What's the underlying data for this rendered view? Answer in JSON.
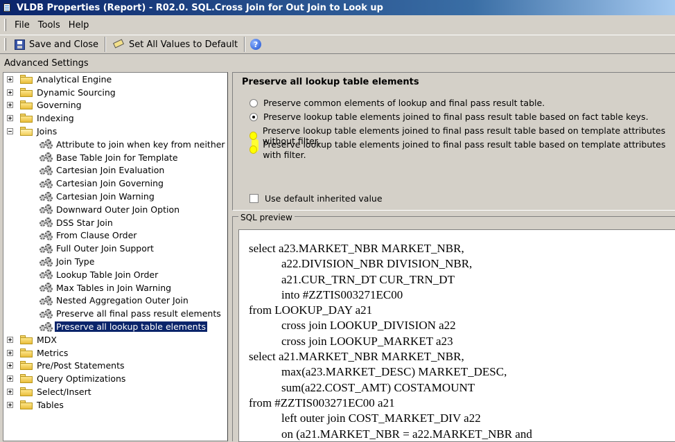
{
  "window": {
    "title": "VLDB Properties (Report) - R02.0. SQL.Cross Join for Out Join to Look up"
  },
  "menu": {
    "file": "File",
    "tools": "Tools",
    "help": "Help"
  },
  "toolbar": {
    "save_close": "Save and Close",
    "set_defaults": "Set All Values to Default",
    "help_glyph": "?"
  },
  "advanced_settings_label": "Advanced Settings",
  "tree": {
    "top": [
      "Analytical Engine",
      "Dynamic Sourcing",
      "Governing",
      "Indexing"
    ],
    "joins": {
      "label": "Joins",
      "children": [
        "Attribute to join when key from neither side can be supported by the other side",
        "Base Table Join for Template",
        "Cartesian Join Evaluation",
        "Cartesian Join Governing",
        "Cartesian Join Warning",
        "Downward Outer Join Option",
        "DSS Star Join",
        "From Clause Order",
        "Full Outer Join Support",
        "Join Type",
        "Lookup Table Join Order",
        "Max Tables in Join Warning",
        "Nested Aggregation Outer Join",
        "Preserve all final pass result elements",
        "Preserve all lookup table elements"
      ]
    },
    "bottom": [
      "MDX",
      "Metrics",
      "Pre/Post Statements",
      "Query Optimizations",
      "Select/Insert",
      "Tables"
    ]
  },
  "setting": {
    "title": "Preserve all lookup table elements",
    "options": [
      "Preserve common elements of lookup and final pass result table.",
      "Preserve lookup table elements joined to final pass result table based on fact table keys.",
      "Preserve lookup table elements joined to final pass result table based on template attributes without filter.",
      "Preserve lookup table elements joined to final pass result table based on template attributes with filter."
    ],
    "selected_index": 1,
    "use_default": "Use default inherited value"
  },
  "sql_preview": {
    "label": "SQL preview",
    "lines": [
      "select a23.MARKET_NBR MARKET_NBR,",
      "a22.DIVISION_NBR DIVISION_NBR,",
      "a21.CUR_TRN_DT CUR_TRN_DT",
      "into #ZZTIS003271EC00",
      "from LOOKUP_DAY a21",
      "cross join LOOKUP_DIVISION a22",
      "cross join LOOKUP_MARKET a23",
      "select a21.MARKET_NBR MARKET_NBR,",
      "max(a23.MARKET_DESC) MARKET_DESC,",
      "sum(a22.COST_AMT) COSTAMOUNT",
      "from #ZZTIS003271EC00 a21",
      "left outer join COST_MARKET_DIV a22",
      "on (a21.MARKET_NBR = a22.MARKET_NBR and"
    ]
  },
  "colors": {
    "title_bar": "#0a246a",
    "selection": "#0a246a",
    "highlight": "#ffff00",
    "dialog_bg": "#d4d0c8"
  }
}
